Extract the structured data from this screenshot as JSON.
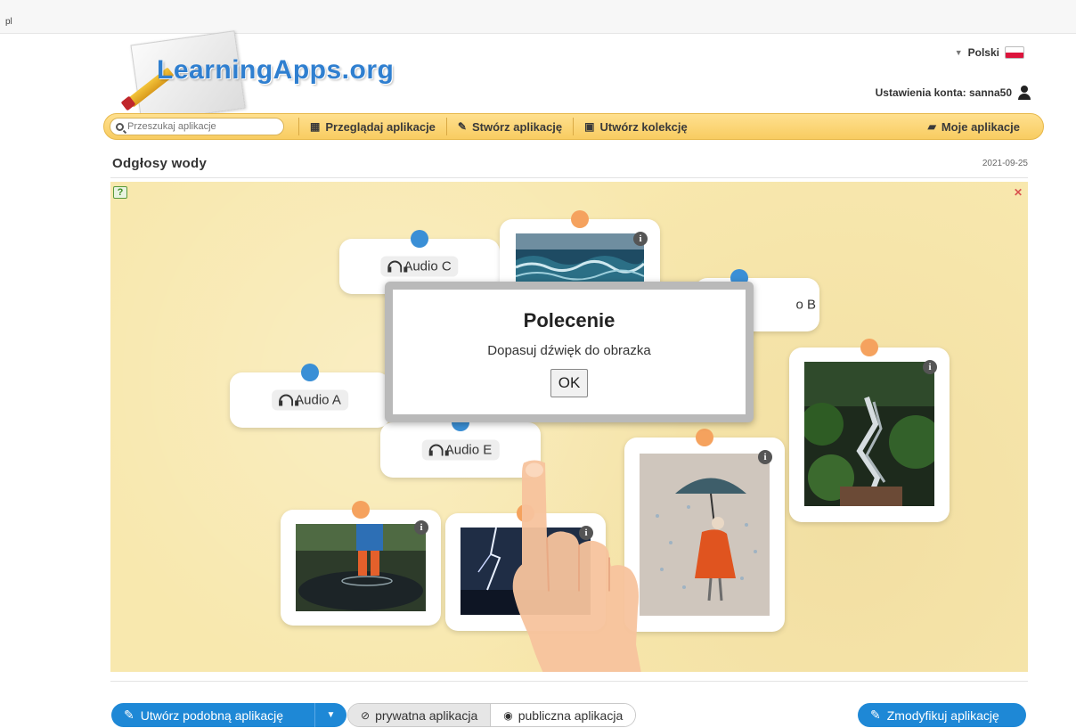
{
  "browser": {
    "url_fragment": "pl"
  },
  "header": {
    "logo_text": "LearningApps.org",
    "language": "Polski",
    "account_label": "Ustawienia konta: sanna50"
  },
  "nav": {
    "search_placeholder": "Przeszukaj aplikacje",
    "items": [
      {
        "label": "Przeglądaj aplikacje",
        "icon": "grid-icon"
      },
      {
        "label": "Stwórz aplikację",
        "icon": "pencil-icon"
      },
      {
        "label": "Utwórz kolekcję",
        "icon": "collection-icon"
      }
    ],
    "my_apps": {
      "label": "Moje aplikacje",
      "icon": "folder-icon"
    }
  },
  "app": {
    "title": "Odgłosy wody",
    "date": "2021-09-25"
  },
  "board": {
    "audio_cards": [
      {
        "label": "Audio C"
      },
      {
        "label": "o B"
      },
      {
        "label": "Audio A"
      },
      {
        "label": "Audio E"
      }
    ],
    "image_cards": [
      {
        "subject": "sea-waves-photo"
      },
      {
        "subject": "forest-waterfall-photo"
      },
      {
        "subject": "girl-umbrella-rain-illustration"
      },
      {
        "subject": "boots-in-puddle-photo"
      },
      {
        "subject": "lightning-storm-photo"
      }
    ],
    "colors": {
      "background": "#f8e8ae",
      "pin_blue": "#3a8fd6",
      "pin_orange": "#f5a25e"
    }
  },
  "modal": {
    "title": "Polecenie",
    "text": "Dopasuj dźwięk do obrazka",
    "ok_label": "OK"
  },
  "bottom": {
    "create_similar_label": "Utwórz podobną aplikację",
    "private_label": "prywatna aplikacja",
    "public_label": "publiczna aplikacja",
    "modify_label": "Zmodyfikuj aplikację",
    "accent": "#1e88d6"
  }
}
